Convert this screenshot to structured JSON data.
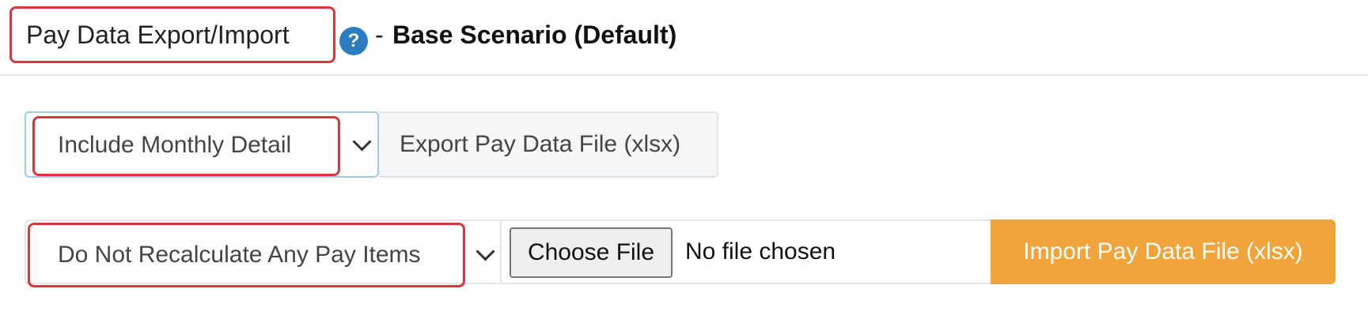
{
  "header": {
    "title": "Pay Data Export/Import",
    "help_icon": "help-icon",
    "separator": "-",
    "scenario": "Base Scenario (Default)"
  },
  "export": {
    "select_value": "Include Monthly Detail",
    "button_label": "Export Pay Data File (xlsx)"
  },
  "import": {
    "select_value": "Do Not Recalculate Any Pay Items",
    "choose_file_label": "Choose File",
    "file_status": "No file chosen",
    "button_label": "Import Pay Data File (xlsx)"
  },
  "colors": {
    "highlight": "#d9373d",
    "help_icon": "#2b7cc0",
    "import_button": "#f0a43a",
    "export_select_focus": "#9ecbf0"
  }
}
